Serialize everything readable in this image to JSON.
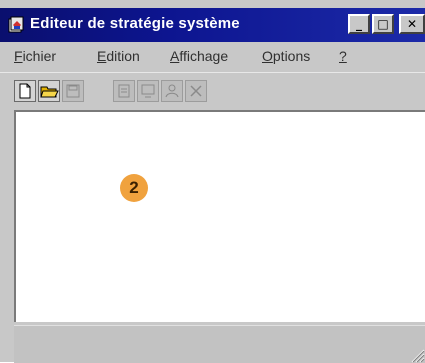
{
  "window": {
    "title": "Editeur de stratégie système",
    "title_buttons": {
      "minimize": "_",
      "maximize": "□",
      "close": "✕"
    }
  },
  "menu": [
    {
      "pre": "",
      "key": "F",
      "post": "ichier"
    },
    {
      "pre": "",
      "key": "E",
      "post": "dition"
    },
    {
      "pre": "",
      "key": "A",
      "post": "ffichage"
    },
    {
      "pre": "",
      "key": "O",
      "post": "ptions"
    },
    {
      "pre": "",
      "key": "?",
      "post": ""
    }
  ],
  "toolbar": {
    "tools": [
      {
        "icon": "new-document-icon",
        "enabled": true
      },
      {
        "icon": "open-folder-icon",
        "enabled": true
      },
      {
        "icon": "save-disk-icon",
        "enabled": false
      },
      {
        "icon": "properties-icon",
        "enabled": false
      },
      {
        "icon": "add-computer-icon",
        "enabled": false
      },
      {
        "icon": "add-user-icon",
        "enabled": false
      },
      {
        "icon": "remove-icon",
        "enabled": false
      }
    ]
  },
  "annotation": {
    "badge": "2",
    "color": "#f0a23e"
  },
  "colors": {
    "titlebar": "#0d1590",
    "chrome": "#c8c8c8",
    "content": "#ffffff"
  }
}
